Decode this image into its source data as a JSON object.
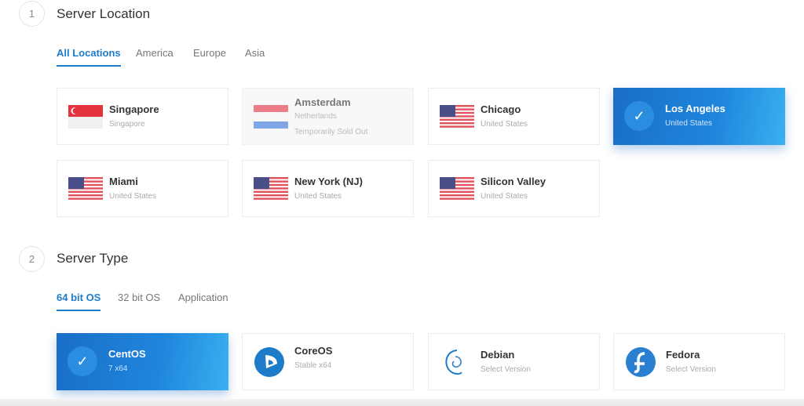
{
  "location": {
    "step": "1",
    "title": "Server Location",
    "tabs": [
      {
        "label": "All Locations",
        "active": true
      },
      {
        "label": "America"
      },
      {
        "label": "Europe"
      },
      {
        "label": "Asia"
      }
    ],
    "cards": [
      {
        "name": "Singapore",
        "sub": "Singapore",
        "flag": "sg"
      },
      {
        "name": "Amsterdam",
        "sub": "Netherlands",
        "note": "Temporarily Sold Out",
        "flag": "nl",
        "disabled": true
      },
      {
        "name": "Chicago",
        "sub": "United States",
        "flag": "us"
      },
      {
        "name": "Los Angeles",
        "sub": "United States",
        "selected": true
      },
      {
        "name": "Miami",
        "sub": "United States",
        "flag": "us"
      },
      {
        "name": "New York (NJ)",
        "sub": "United States",
        "flag": "us"
      },
      {
        "name": "Silicon Valley",
        "sub": "United States",
        "flag": "us"
      }
    ]
  },
  "type": {
    "step": "2",
    "title": "Server Type",
    "tabs": [
      {
        "label": "64 bit OS",
        "active": true
      },
      {
        "label": "32 bit OS"
      },
      {
        "label": "Application"
      }
    ],
    "cards": [
      {
        "name": "CentOS",
        "sub": "7  x64",
        "selected": true
      },
      {
        "name": "CoreOS",
        "sub": "Stable  x64",
        "icon": "coreos"
      },
      {
        "name": "Debian",
        "sub": "Select Version",
        "icon": "debian"
      },
      {
        "name": "Fedora",
        "sub": "Select Version",
        "icon": "fedora"
      }
    ]
  },
  "colors": {
    "accent": "#1e7bc8"
  }
}
